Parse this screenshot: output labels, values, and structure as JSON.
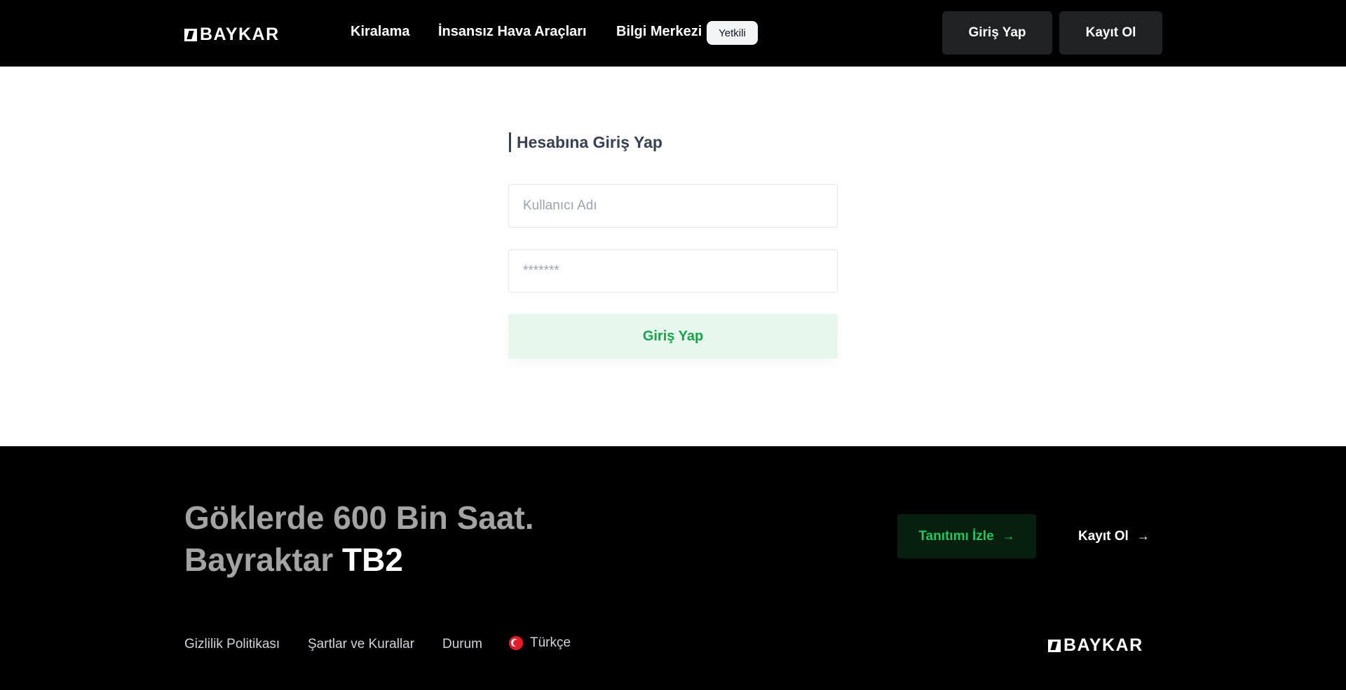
{
  "header": {
    "logo_text": "BAYKAR",
    "nav": {
      "rent": "Kiralama",
      "uav": "İnsansız Hava Araçları",
      "knowledge": "Bilgi Merkezi",
      "badge": "Yetkili"
    },
    "login_btn": "Giriş Yap",
    "register_btn": "Kayıt Ol"
  },
  "login": {
    "title": "Hesabına Giriş Yap",
    "username_placeholder": "Kullanıcı Adı",
    "password_placeholder": "*******",
    "submit": "Giriş Yap"
  },
  "footer": {
    "hero_line1": "Göklerde 600 Bin Saat.",
    "hero_line2_prefix": "Bayraktar",
    "hero_line2_strong": "TB2",
    "watch_btn": "Tanıtımı İzle",
    "register_link": "Kayıt Ol",
    "links": {
      "privacy": "Gizlilik Politikası",
      "terms": "Şartlar ve Kurallar",
      "status": "Durum"
    },
    "language": "Türkçe",
    "logo_text": "BAYKAR"
  },
  "icons": {
    "arrow": "arrow-right-icon",
    "flag": "turkey-flag-icon",
    "logo": "baykar-logo-icon"
  },
  "colors": {
    "header_bg": "#000000",
    "accent_green": "#16a34a",
    "login_btn_bg": "#e6f7ee",
    "footer_bg": "#000000"
  }
}
